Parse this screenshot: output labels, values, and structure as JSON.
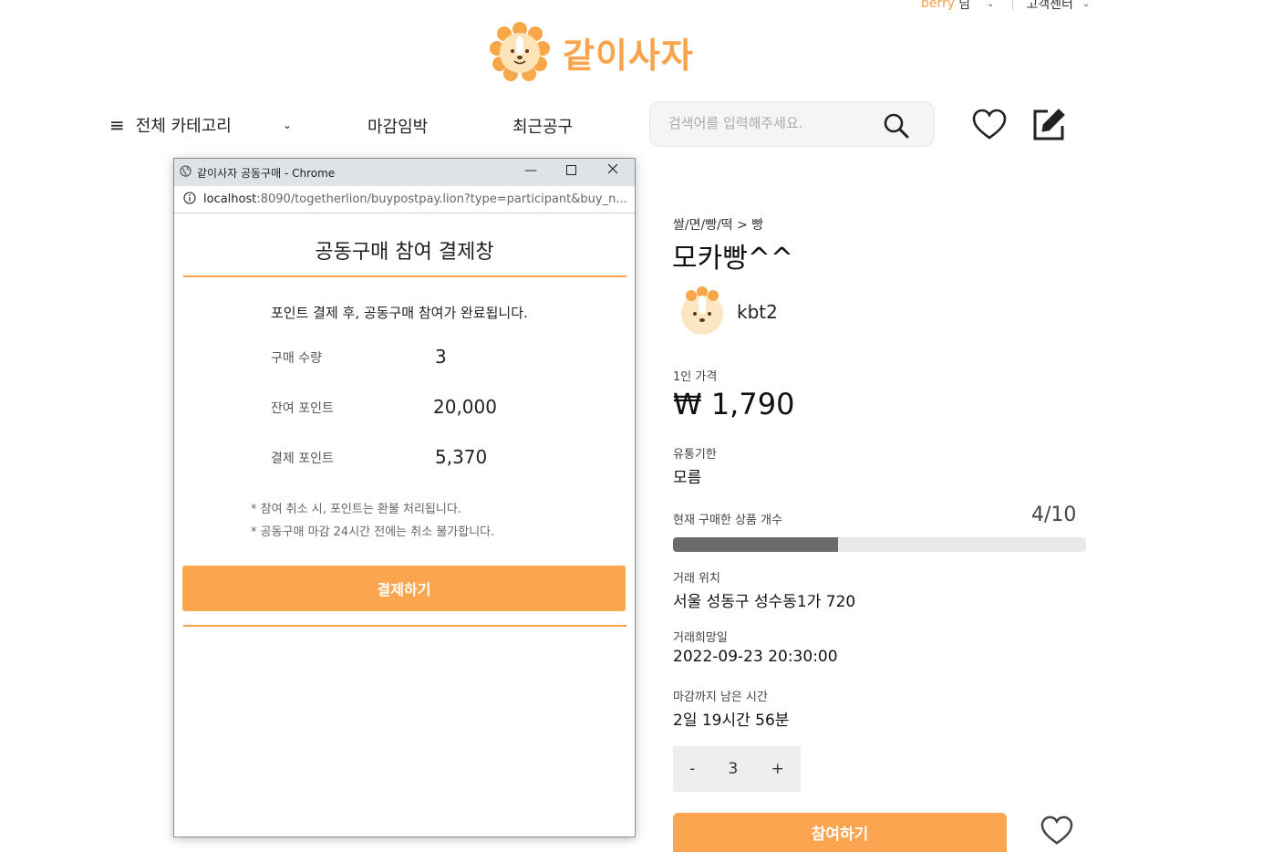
{
  "header": {
    "user_name": "berry",
    "user_suffix": "님",
    "customer_center": "고객센터",
    "brand": "같이사자",
    "colors": {
      "accent": "#fba34a"
    }
  },
  "nav": {
    "all_categories": "전체 카테고리",
    "closing_soon": "마감임박",
    "recent": "최근공구",
    "search_placeholder": "검색어를 입력해주세요."
  },
  "product": {
    "breadcrumb": "쌀/면/빵/떡 > 빵",
    "title": "모카빵^^",
    "seller": "kbt2",
    "price_label": "1인 가격",
    "price": "₩ 1,790",
    "expiry_label": "유통기한",
    "expiry": "모름",
    "purchased_label": "현재 구매한 상품 개수",
    "purchased_count": "4/10",
    "progress": 0.4,
    "location_label": "거래 위치",
    "location": "서울 성동구 성수동1가 720",
    "date_label": "거래희망일",
    "date": "2022-09-23 20:30:00",
    "remaining_label": "마감까지 남은 시간",
    "remaining": "2일 19시간 56분",
    "quantity": "3",
    "minus": "-",
    "plus": "+",
    "join_button": "참여하기"
  },
  "popup": {
    "window_title": "같이사자 공동구매 - Chrome",
    "url_host": "localhost",
    "url_path": ":8090/togetherlion/buypostpay.lion?type=participant&buy_n...",
    "heading": "공동구매 참여 결제창",
    "message": "포인트 결제 후, 공동구매 참여가 완료됩니다.",
    "qty_label": "구매 수량",
    "qty_value": "3",
    "balance_label": "잔여 포인트",
    "balance_value": "20,000",
    "pay_label": "결제 포인트",
    "pay_value": "5,370",
    "note1": "* 참여 취소 시, 포인트는 환불 처리됩니다.",
    "note2": "* 공동구매 마감 24시간 전에는 취소 불가합니다.",
    "pay_button": "결제하기"
  }
}
